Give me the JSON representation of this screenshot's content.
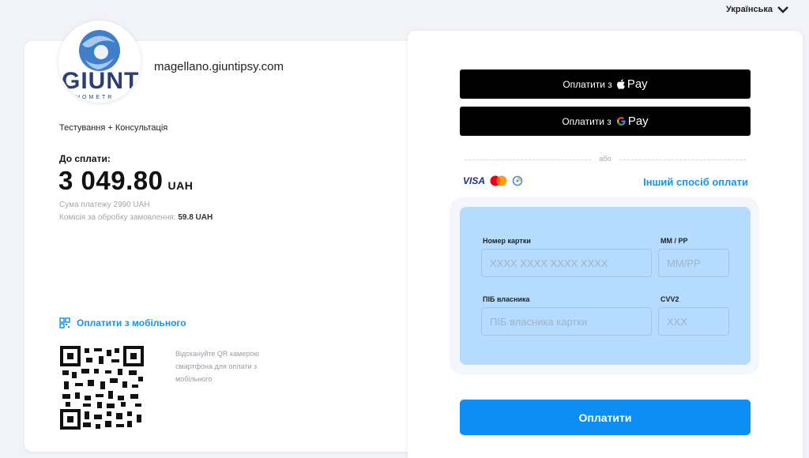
{
  "language": {
    "label": "Українська"
  },
  "merchant": {
    "logo_text": "GIUNTI",
    "logo_sub": "HOMETR",
    "domain": "magellano.giuntipsy.com"
  },
  "order": {
    "description": "Тестування + Консультація",
    "amount_label": "До сплати:",
    "amount": "3 049.80",
    "currency": "UAH",
    "payment_sum_text": "Сума платежу 2990 UAH",
    "commission_label": "Комісія за обробку замовлення:",
    "commission_value": "59.8 UAH"
  },
  "mobile": {
    "link_label": "Оплатити з мобільного",
    "qr_hint": "Відскануйте QR камерою смартфона для оплати з мобільного"
  },
  "wallets": {
    "apple_label": "Оплатити з",
    "apple_brand": "Pay",
    "google_label": "Оплатити з",
    "google_brand": "Pay"
  },
  "divider_text": "або",
  "card_brands": {
    "visa": "VISA"
  },
  "other_method_label": "Інший спосіб оплати",
  "card_form": {
    "card_number_label": "Номер картки",
    "card_number_placeholder": "XXXX XXXX XXXX XXXX",
    "expiry_label": "ММ / РР",
    "expiry_placeholder": "ММ/РР",
    "holder_label": "ПІБ власника",
    "holder_placeholder": "ПІБ власника картки",
    "cvv_label": "CVV2",
    "cvv_placeholder": "XXX"
  },
  "submit_label": "Оплатити",
  "colors": {
    "accent": "#0c8ef5",
    "link": "#1992e8",
    "form_bg": "#b5dcfe",
    "wallet_btn": "#000000"
  }
}
